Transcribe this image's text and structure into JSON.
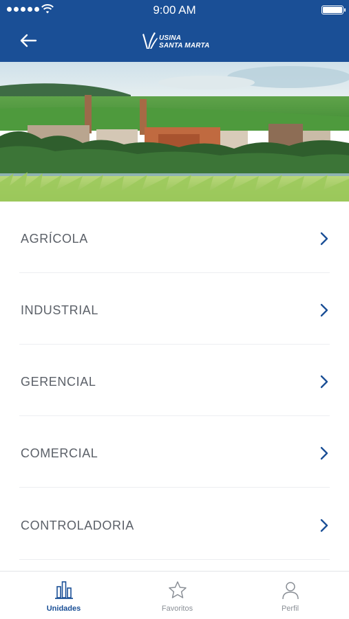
{
  "status_bar": {
    "time": "9:00 AM"
  },
  "header": {
    "logo_line1": "USINA",
    "logo_line2": "SANTA MARTA",
    "back_icon": "arrow-left-icon",
    "accent_color": "#1a4f96"
  },
  "hero": {
    "image": "sugar-mill-landscape-photo"
  },
  "menu": {
    "items": [
      {
        "label": "AGRÍCOLA"
      },
      {
        "label": "INDUSTRIAL"
      },
      {
        "label": "GERENCIAL"
      },
      {
        "label": "COMERCIAL"
      },
      {
        "label": "CONTROLADORIA"
      }
    ],
    "chevron_icon": "chevron-right-icon"
  },
  "tabbar": {
    "tabs": [
      {
        "label": "Unidades",
        "icon": "building-chart-icon",
        "active": true
      },
      {
        "label": "Favoritos",
        "icon": "star-icon",
        "active": false
      },
      {
        "label": "Perfil",
        "icon": "user-icon",
        "active": false
      }
    ]
  }
}
